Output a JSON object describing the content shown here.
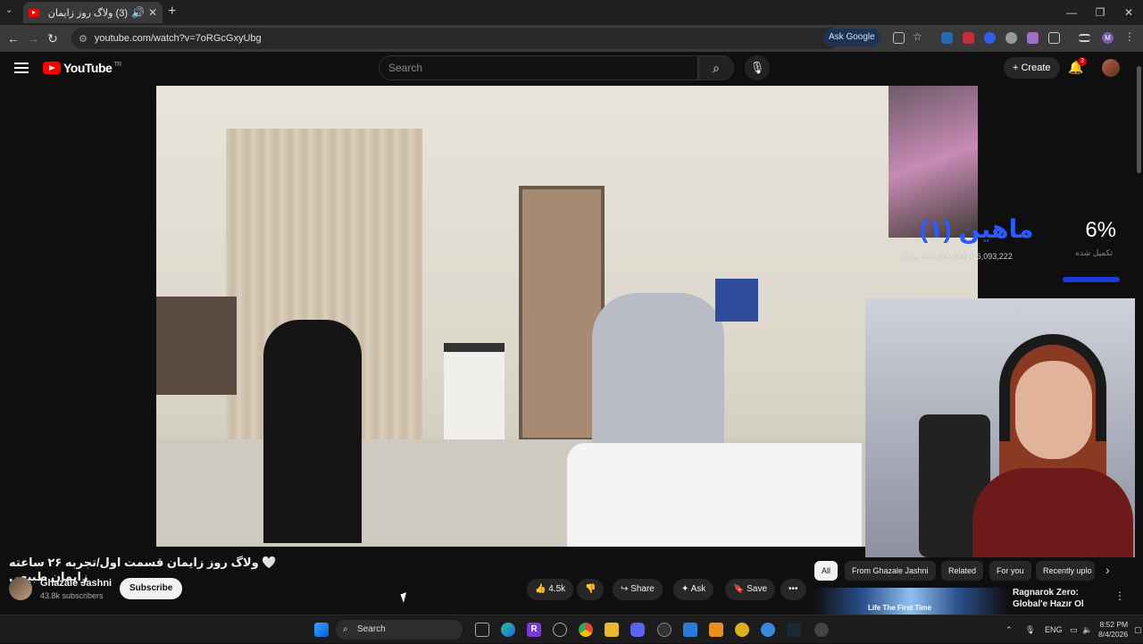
{
  "browser": {
    "tab_title": "(3) ولاگ روز زایمان قسمت اول",
    "url": "youtube.com/watch?v=7oRGcGxyUbg",
    "ask_google": "Ask Google"
  },
  "youtube": {
    "logo_text": "YouTube",
    "region": "TR",
    "search_placeholder": "Search",
    "create_label": "Create",
    "notif_count": "3"
  },
  "overlay": {
    "name": "ماهین (۱)",
    "percent": "6%",
    "percent_label": "تکمیل شده",
    "amount": "6,093,222 از 100,000,000 تومان"
  },
  "video": {
    "title": "🤍 ولاگ روز زایمان قسمت اول/تجربه ۲۶ ساعته زایمان طبیعی",
    "channel_name": "Ghazale Jashni",
    "subscribers": "43.8k subscribers",
    "subscribe_label": "Subscribe",
    "likes": "4.5k",
    "share_label": "Share",
    "ask_label": "Ask",
    "save_label": "Save"
  },
  "chips": [
    "All",
    "From Ghazale Jashni",
    "Related",
    "For you",
    "Recently uplo"
  ],
  "recommendation": {
    "title": "Ragnarok Zero: Global'e Hazır Ol",
    "thumb_text": "Life The First Time"
  },
  "taskbar": {
    "search": "Search",
    "lang": "ENG",
    "time": "8:52 PM",
    "date": "8/4/2026"
  }
}
